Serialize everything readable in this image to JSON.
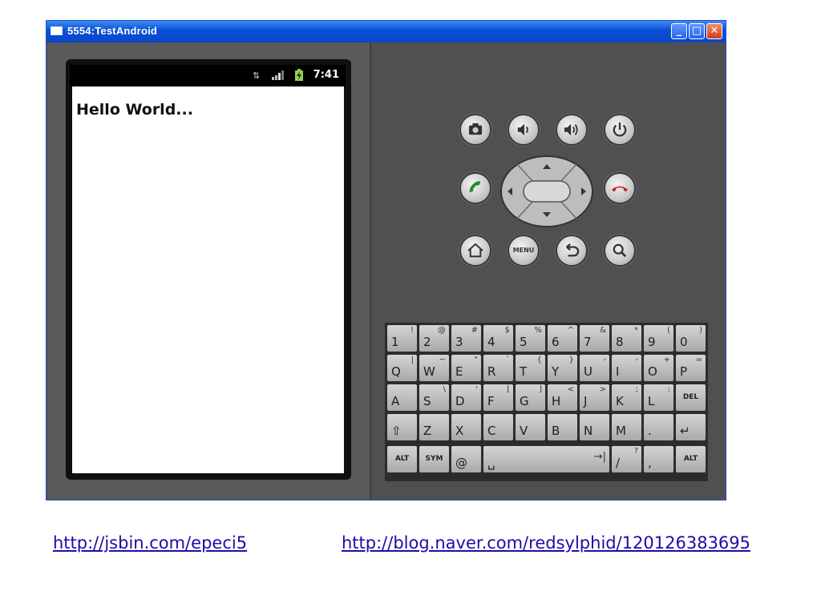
{
  "window": {
    "title": "5554:TestAndroid",
    "minimize_glyph": "_",
    "maximize_glyph": "□",
    "close_glyph": "✕"
  },
  "phone": {
    "status_time": "7:41",
    "screen_text": "Hello World..."
  },
  "controls": {
    "menu_label": "MENU"
  },
  "keyboard": {
    "rows": [
      [
        {
          "main": "1",
          "alt": "!"
        },
        {
          "main": "2",
          "alt": "@"
        },
        {
          "main": "3",
          "alt": "#"
        },
        {
          "main": "4",
          "alt": "$"
        },
        {
          "main": "5",
          "alt": "%"
        },
        {
          "main": "6",
          "alt": "^"
        },
        {
          "main": "7",
          "alt": "&"
        },
        {
          "main": "8",
          "alt": "*"
        },
        {
          "main": "9",
          "alt": "("
        },
        {
          "main": "0",
          "alt": ")"
        }
      ],
      [
        {
          "main": "Q",
          "alt": "|"
        },
        {
          "main": "W",
          "alt": "~"
        },
        {
          "main": "E",
          "alt": "\""
        },
        {
          "main": "R",
          "alt": "`"
        },
        {
          "main": "T",
          "alt": "{"
        },
        {
          "main": "Y",
          "alt": "}"
        },
        {
          "main": "U",
          "alt": "-"
        },
        {
          "main": "I",
          "alt": "-"
        },
        {
          "main": "O",
          "alt": "+"
        },
        {
          "main": "P",
          "alt": "="
        }
      ],
      [
        {
          "main": "A",
          "alt": ""
        },
        {
          "main": "S",
          "alt": "\\"
        },
        {
          "main": "D",
          "alt": "'"
        },
        {
          "main": "F",
          "alt": "["
        },
        {
          "main": "G",
          "alt": "]"
        },
        {
          "main": "H",
          "alt": "<"
        },
        {
          "main": "J",
          "alt": ">"
        },
        {
          "main": "K",
          "alt": ";"
        },
        {
          "main": "L",
          "alt": ":"
        },
        {
          "main": "DEL",
          "alt": "",
          "small": true
        }
      ],
      [
        {
          "main": "⇧",
          "alt": ""
        },
        {
          "main": "Z",
          "alt": ""
        },
        {
          "main": "X",
          "alt": ""
        },
        {
          "main": "C",
          "alt": ""
        },
        {
          "main": "V",
          "alt": ""
        },
        {
          "main": "B",
          "alt": ""
        },
        {
          "main": "N",
          "alt": ""
        },
        {
          "main": "M",
          "alt": ""
        },
        {
          "main": ".",
          "alt": ""
        },
        {
          "main": "↵",
          "alt": ""
        }
      ],
      [
        {
          "main": "ALT",
          "alt": "",
          "small": true
        },
        {
          "main": "SYM",
          "alt": "",
          "small": true
        },
        {
          "main": "@",
          "alt": ""
        },
        {
          "main": "␣",
          "alt": "→|",
          "wide": true
        },
        {
          "main": "/",
          "alt": "?"
        },
        {
          "main": ",",
          "alt": ""
        },
        {
          "main": "ALT",
          "alt": "",
          "small": true
        }
      ]
    ]
  },
  "links": {
    "link1": "http://jsbin.com/epeci5",
    "link2": "http://blog.naver.com/redsylphid/120126383695"
  },
  "colors": {
    "titlebar": "#0a4fd6",
    "body": "#505050",
    "link": "#1a0dab",
    "call_green": "#1c8a2e",
    "end_red": "#c21818"
  }
}
